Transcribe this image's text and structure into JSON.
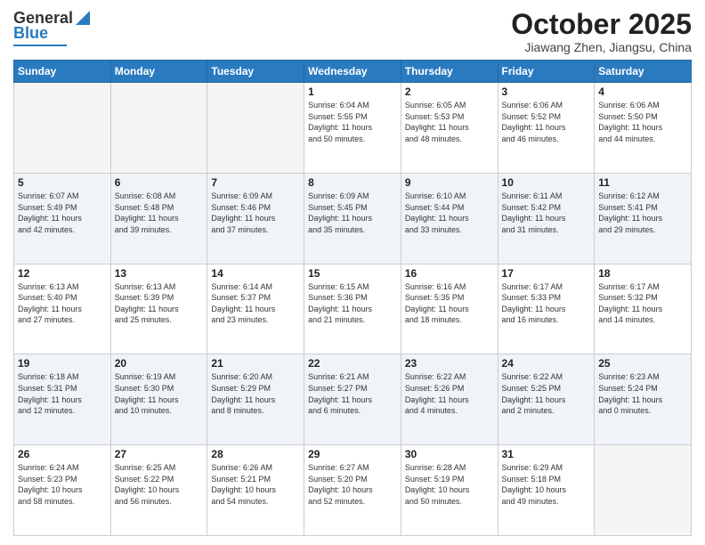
{
  "header": {
    "logo_general": "General",
    "logo_blue": "Blue",
    "month": "October 2025",
    "location": "Jiawang Zhen, Jiangsu, China"
  },
  "days_of_week": [
    "Sunday",
    "Monday",
    "Tuesday",
    "Wednesday",
    "Thursday",
    "Friday",
    "Saturday"
  ],
  "weeks": [
    [
      {
        "day": "",
        "info": ""
      },
      {
        "day": "",
        "info": ""
      },
      {
        "day": "",
        "info": ""
      },
      {
        "day": "1",
        "info": "Sunrise: 6:04 AM\nSunset: 5:55 PM\nDaylight: 11 hours\nand 50 minutes."
      },
      {
        "day": "2",
        "info": "Sunrise: 6:05 AM\nSunset: 5:53 PM\nDaylight: 11 hours\nand 48 minutes."
      },
      {
        "day": "3",
        "info": "Sunrise: 6:06 AM\nSunset: 5:52 PM\nDaylight: 11 hours\nand 46 minutes."
      },
      {
        "day": "4",
        "info": "Sunrise: 6:06 AM\nSunset: 5:50 PM\nDaylight: 11 hours\nand 44 minutes."
      }
    ],
    [
      {
        "day": "5",
        "info": "Sunrise: 6:07 AM\nSunset: 5:49 PM\nDaylight: 11 hours\nand 42 minutes."
      },
      {
        "day": "6",
        "info": "Sunrise: 6:08 AM\nSunset: 5:48 PM\nDaylight: 11 hours\nand 39 minutes."
      },
      {
        "day": "7",
        "info": "Sunrise: 6:09 AM\nSunset: 5:46 PM\nDaylight: 11 hours\nand 37 minutes."
      },
      {
        "day": "8",
        "info": "Sunrise: 6:09 AM\nSunset: 5:45 PM\nDaylight: 11 hours\nand 35 minutes."
      },
      {
        "day": "9",
        "info": "Sunrise: 6:10 AM\nSunset: 5:44 PM\nDaylight: 11 hours\nand 33 minutes."
      },
      {
        "day": "10",
        "info": "Sunrise: 6:11 AM\nSunset: 5:42 PM\nDaylight: 11 hours\nand 31 minutes."
      },
      {
        "day": "11",
        "info": "Sunrise: 6:12 AM\nSunset: 5:41 PM\nDaylight: 11 hours\nand 29 minutes."
      }
    ],
    [
      {
        "day": "12",
        "info": "Sunrise: 6:13 AM\nSunset: 5:40 PM\nDaylight: 11 hours\nand 27 minutes."
      },
      {
        "day": "13",
        "info": "Sunrise: 6:13 AM\nSunset: 5:39 PM\nDaylight: 11 hours\nand 25 minutes."
      },
      {
        "day": "14",
        "info": "Sunrise: 6:14 AM\nSunset: 5:37 PM\nDaylight: 11 hours\nand 23 minutes."
      },
      {
        "day": "15",
        "info": "Sunrise: 6:15 AM\nSunset: 5:36 PM\nDaylight: 11 hours\nand 21 minutes."
      },
      {
        "day": "16",
        "info": "Sunrise: 6:16 AM\nSunset: 5:35 PM\nDaylight: 11 hours\nand 18 minutes."
      },
      {
        "day": "17",
        "info": "Sunrise: 6:17 AM\nSunset: 5:33 PM\nDaylight: 11 hours\nand 16 minutes."
      },
      {
        "day": "18",
        "info": "Sunrise: 6:17 AM\nSunset: 5:32 PM\nDaylight: 11 hours\nand 14 minutes."
      }
    ],
    [
      {
        "day": "19",
        "info": "Sunrise: 6:18 AM\nSunset: 5:31 PM\nDaylight: 11 hours\nand 12 minutes."
      },
      {
        "day": "20",
        "info": "Sunrise: 6:19 AM\nSunset: 5:30 PM\nDaylight: 11 hours\nand 10 minutes."
      },
      {
        "day": "21",
        "info": "Sunrise: 6:20 AM\nSunset: 5:29 PM\nDaylight: 11 hours\nand 8 minutes."
      },
      {
        "day": "22",
        "info": "Sunrise: 6:21 AM\nSunset: 5:27 PM\nDaylight: 11 hours\nand 6 minutes."
      },
      {
        "day": "23",
        "info": "Sunrise: 6:22 AM\nSunset: 5:26 PM\nDaylight: 11 hours\nand 4 minutes."
      },
      {
        "day": "24",
        "info": "Sunrise: 6:22 AM\nSunset: 5:25 PM\nDaylight: 11 hours\nand 2 minutes."
      },
      {
        "day": "25",
        "info": "Sunrise: 6:23 AM\nSunset: 5:24 PM\nDaylight: 11 hours\nand 0 minutes."
      }
    ],
    [
      {
        "day": "26",
        "info": "Sunrise: 6:24 AM\nSunset: 5:23 PM\nDaylight: 10 hours\nand 58 minutes."
      },
      {
        "day": "27",
        "info": "Sunrise: 6:25 AM\nSunset: 5:22 PM\nDaylight: 10 hours\nand 56 minutes."
      },
      {
        "day": "28",
        "info": "Sunrise: 6:26 AM\nSunset: 5:21 PM\nDaylight: 10 hours\nand 54 minutes."
      },
      {
        "day": "29",
        "info": "Sunrise: 6:27 AM\nSunset: 5:20 PM\nDaylight: 10 hours\nand 52 minutes."
      },
      {
        "day": "30",
        "info": "Sunrise: 6:28 AM\nSunset: 5:19 PM\nDaylight: 10 hours\nand 50 minutes."
      },
      {
        "day": "31",
        "info": "Sunrise: 6:29 AM\nSunset: 5:18 PM\nDaylight: 10 hours\nand 49 minutes."
      },
      {
        "day": "",
        "info": ""
      }
    ]
  ]
}
